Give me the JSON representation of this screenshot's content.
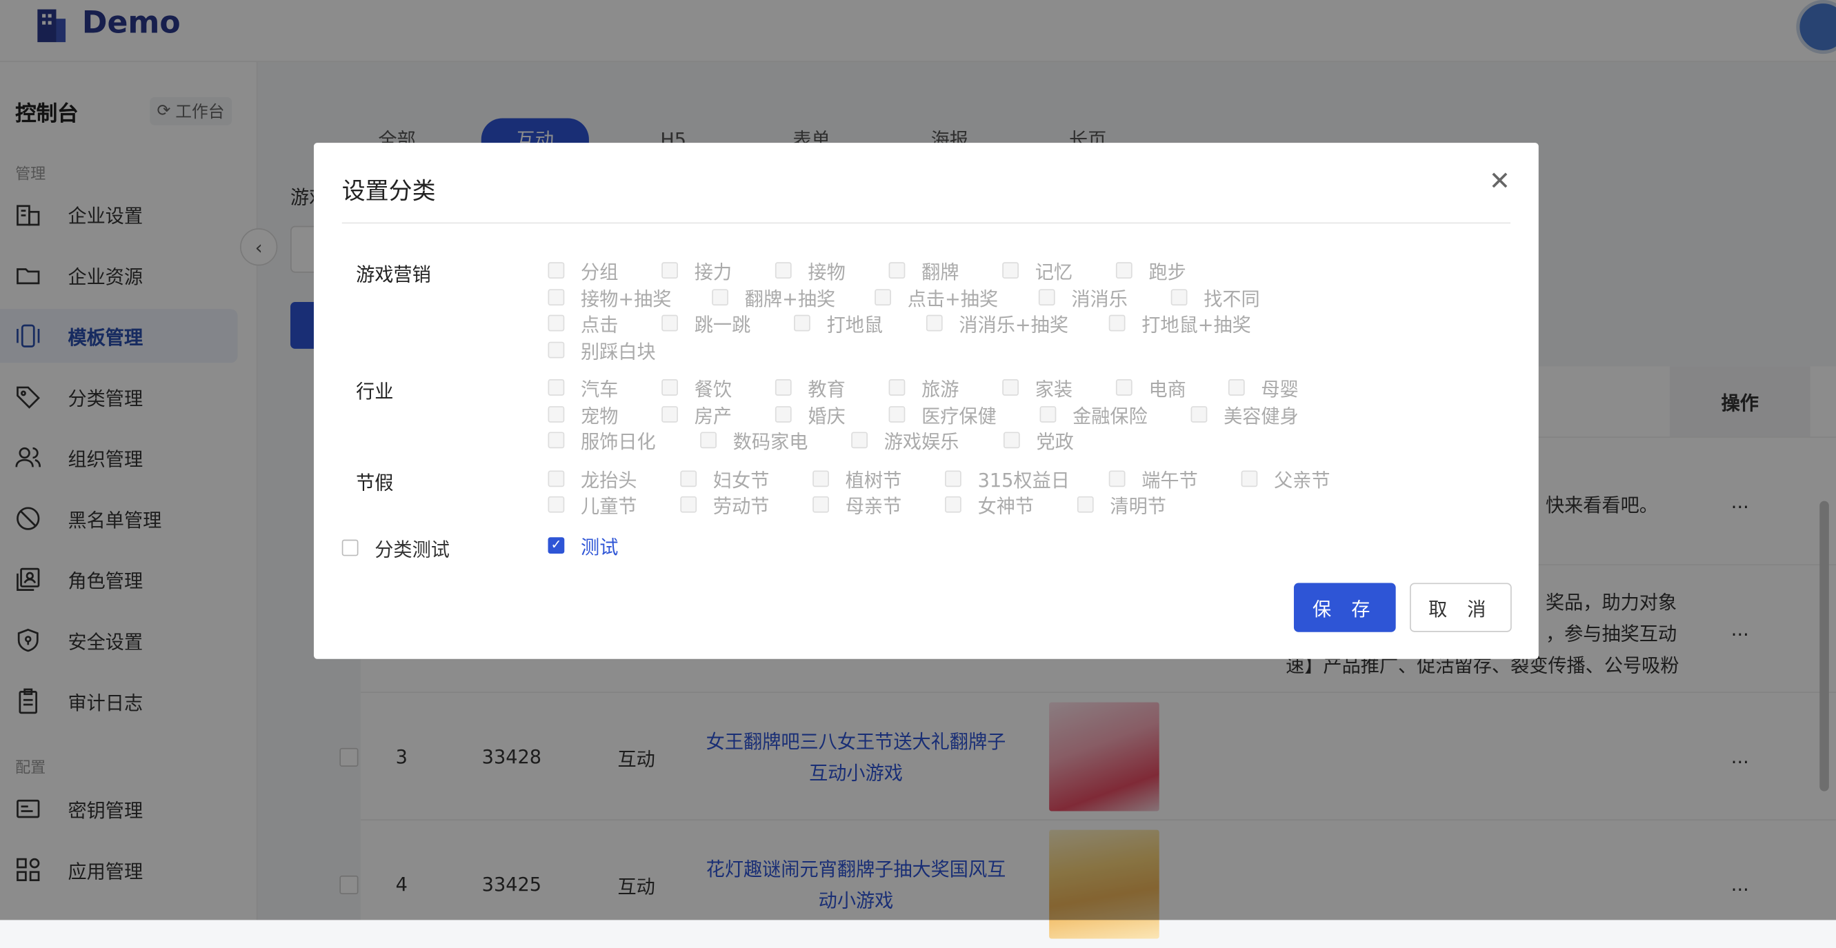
{
  "header": {
    "logo_text": "Demo"
  },
  "sidebar": {
    "title": "控制台",
    "workbench_label": "工作台",
    "group_manage": "管理",
    "group_config": "配置",
    "items": [
      {
        "label": "企业设置",
        "icon": "building-icon"
      },
      {
        "label": "企业资源",
        "icon": "folder-icon"
      },
      {
        "label": "模板管理",
        "icon": "template-icon",
        "active": true
      },
      {
        "label": "分类管理",
        "icon": "tag-icon"
      },
      {
        "label": "组织管理",
        "icon": "users-icon"
      },
      {
        "label": "黑名单管理",
        "icon": "ban-icon"
      },
      {
        "label": "角色管理",
        "icon": "role-icon"
      },
      {
        "label": "安全设置",
        "icon": "shield-icon"
      },
      {
        "label": "审计日志",
        "icon": "clipboard-icon"
      },
      {
        "label": "密钥管理",
        "icon": "key-card-icon"
      },
      {
        "label": "应用管理",
        "icon": "apps-icon"
      }
    ]
  },
  "main": {
    "tabs": [
      "全部",
      "互动",
      "H5",
      "表单",
      "海报",
      "长页"
    ],
    "filter_label": "游戏",
    "ops_header": "操作",
    "rows": [
      {
        "desc_lines": [
          "快来看看吧。"
        ],
        "ops": "..."
      },
      {
        "desc_lines": [
          "奖品，助力对象",
          "，参与抽奖互动",
          "速】产品推广、促活留存、裂变传播、公号吸粉"
        ],
        "ops": "..."
      },
      {
        "index": "3",
        "id": "33428",
        "type": "互动",
        "title": "女王翻牌吧三八女王节送大礼翻牌子互动小游戏",
        "ops": "..."
      },
      {
        "index": "4",
        "id": "33425",
        "type": "互动",
        "title": "花灯趣谜闹元宵翻牌子抽大奖国风互动小游戏",
        "ops": "..."
      }
    ]
  },
  "dialog": {
    "title": "设置分类",
    "categories": [
      {
        "name": "游戏营销",
        "rows": [
          [
            "分组",
            "接力",
            "接物",
            "翻牌",
            "记忆",
            "跑步"
          ],
          [
            "接物+抽奖",
            "翻牌+抽奖",
            "点击+抽奖",
            "消消乐",
            "找不同"
          ],
          [
            "点击",
            "跳一跳",
            "打地鼠",
            "消消乐+抽奖",
            "打地鼠+抽奖"
          ],
          [
            "别踩白块"
          ]
        ]
      },
      {
        "name": "行业",
        "rows": [
          [
            "汽车",
            "餐饮",
            "教育",
            "旅游",
            "家装",
            "电商",
            "母婴"
          ],
          [
            "宠物",
            "房产",
            "婚庆",
            "医疗保健",
            "金融保险",
            "美容健身"
          ],
          [
            "服饰日化",
            "数码家电",
            "游戏娱乐",
            "党政"
          ]
        ]
      },
      {
        "name": "节假",
        "rows": [
          [
            "龙抬头",
            "妇女节",
            "植树节",
            "315权益日",
            "端午节",
            "父亲节"
          ],
          [
            "儿童节",
            "劳动节",
            "母亲节",
            "女神节",
            "清明节"
          ]
        ]
      }
    ],
    "test_category": {
      "name": "分类测试",
      "checked": false
    },
    "test_option": {
      "label": "测试",
      "checked": true
    },
    "save_label": "保 存",
    "cancel_label": "取 消"
  },
  "colors": {
    "primary": "#2e55d6",
    "overlay": "rgba(0,0,0,0.45)"
  }
}
